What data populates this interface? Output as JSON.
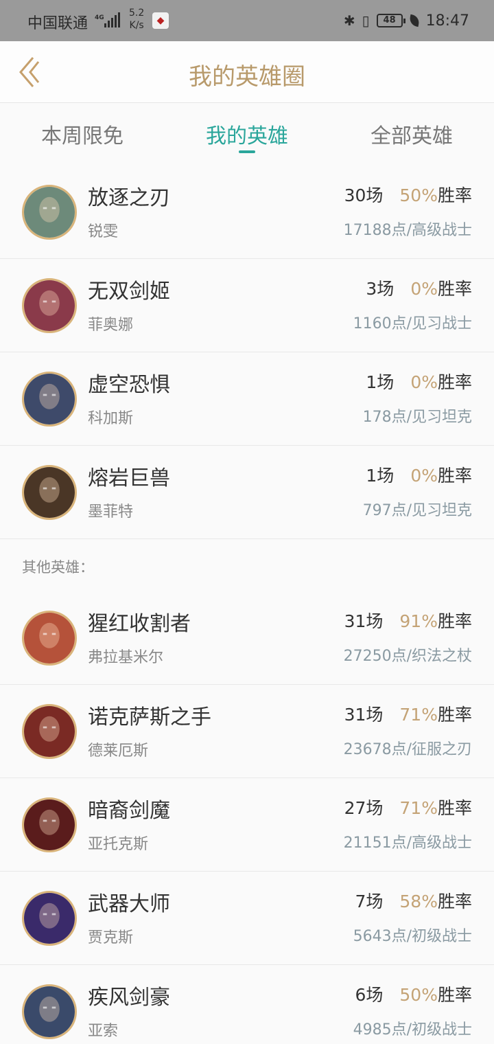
{
  "status_bar": {
    "carrier": "中国联通",
    "network": "4G",
    "speed_top": "5.2",
    "speed_bottom": "K/s",
    "battery": "48",
    "time": "18:47"
  },
  "header": {
    "title": "我的英雄圈"
  },
  "tabs": [
    {
      "label": "本周限免",
      "active": false
    },
    {
      "label": "我的英雄",
      "active": true
    },
    {
      "label": "全部英雄",
      "active": false
    }
  ],
  "my_heroes": [
    {
      "title": "放逐之刃",
      "name": "锐雯",
      "games": "30场",
      "winrate": "50%",
      "winrate_label": "胜率",
      "points": "17188点/高级战士",
      "color": "#6d8a7a"
    },
    {
      "title": "无双剑姬",
      "name": "菲奥娜",
      "games": "3场",
      "winrate": "0%",
      "winrate_label": "胜率",
      "points": "1160点/见习战士",
      "color": "#8a3a4a"
    },
    {
      "title": "虚空恐惧",
      "name": "科加斯",
      "games": "1场",
      "winrate": "0%",
      "winrate_label": "胜率",
      "points": "178点/见习坦克",
      "color": "#3e4a6a"
    },
    {
      "title": "熔岩巨兽",
      "name": "墨菲特",
      "games": "1场",
      "winrate": "0%",
      "winrate_label": "胜率",
      "points": "797点/见习坦克",
      "color": "#4a3626"
    }
  ],
  "other_label": "其他英雄：",
  "other_heroes": [
    {
      "title": "猩红收割者",
      "name": "弗拉基米尔",
      "games": "31场",
      "winrate": "91%",
      "winrate_label": "胜率",
      "points": "27250点/织法之杖",
      "color": "#b5523a"
    },
    {
      "title": "诺克萨斯之手",
      "name": "德莱厄斯",
      "games": "31场",
      "winrate": "71%",
      "winrate_label": "胜率",
      "points": "23678点/征服之刃",
      "color": "#7a2a24"
    },
    {
      "title": "暗裔剑魔",
      "name": "亚托克斯",
      "games": "27场",
      "winrate": "71%",
      "winrate_label": "胜率",
      "points": "21151点/高级战士",
      "color": "#5a1c1c"
    },
    {
      "title": "武器大师",
      "name": "贾克斯",
      "games": "7场",
      "winrate": "58%",
      "winrate_label": "胜率",
      "points": "5643点/初级战士",
      "color": "#3a2a6a"
    },
    {
      "title": "疾风剑豪",
      "name": "亚索",
      "games": "6场",
      "winrate": "50%",
      "winrate_label": "胜率",
      "points": "4985点/初级战士",
      "color": "#3a4a6a"
    }
  ]
}
